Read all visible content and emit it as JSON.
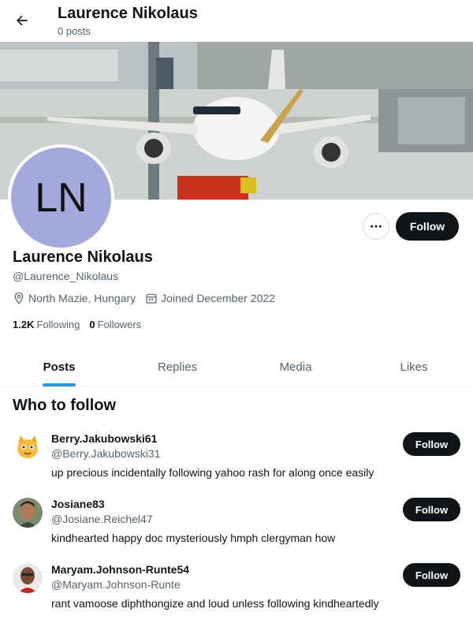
{
  "header": {
    "title": "Laurence Nikolaus",
    "post_count": "0 posts"
  },
  "profile": {
    "avatar_initials": "LN",
    "avatar_color": "#a4a9dc",
    "name": "Laurence Nikolaus",
    "handle": "@Laurence_Nikolaus",
    "location": "North Mazie, Hungary",
    "joined": "Joined December 2022",
    "following_count": "1.2K",
    "following_label": "Following",
    "followers_count": "0",
    "followers_label": "Followers",
    "follow_label": "Follow"
  },
  "tabs": [
    {
      "label": "Posts",
      "active": true
    },
    {
      "label": "Replies",
      "active": false
    },
    {
      "label": "Media",
      "active": false
    },
    {
      "label": "Likes",
      "active": false
    }
  ],
  "who_to_follow": {
    "title": "Who to follow",
    "items": [
      {
        "name": "Berry.Jakubowski61",
        "handle": "@Berry.Jakubowski31",
        "bio": "up precious incidentally following yahoo rash for along once easily",
        "follow_label": "Follow",
        "avatar": "cat-cartoon-avatar"
      },
      {
        "name": "Josiane83",
        "handle": "@Josiane.Reichel47",
        "bio": "kindhearted happy doc mysteriously hmph clergyman how",
        "follow_label": "Follow",
        "avatar": "person-photo-avatar"
      },
      {
        "name": "Maryam.Johnson-Runte54",
        "handle": "@Maryam.Johnson-Runte",
        "bio": "rant vamoose diphthongize and loud unless following kindheartedly",
        "follow_label": "Follow",
        "avatar": "person-photo-avatar"
      }
    ]
  },
  "colors": {
    "accent": "#1d9bf0",
    "button": "#0f1419",
    "secondary_text": "#536471"
  },
  "icons": [
    "arrow-left-icon",
    "more-icon",
    "location-pin-icon",
    "calendar-icon"
  ]
}
